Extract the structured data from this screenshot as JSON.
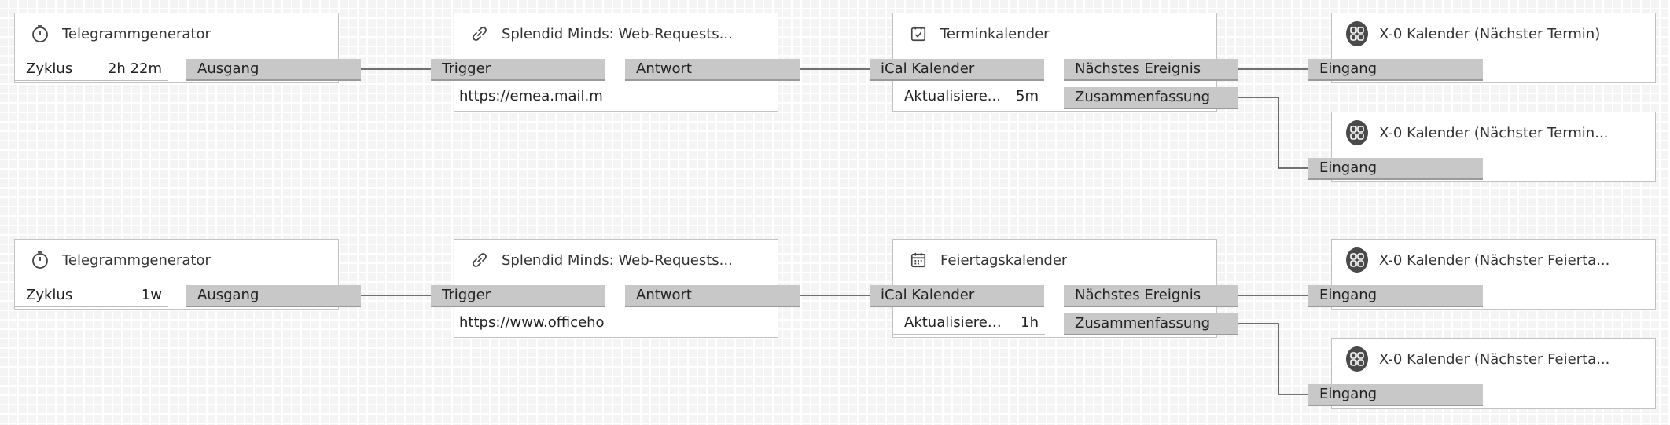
{
  "rows": [
    {
      "generator": {
        "title": "Telegrammgenerator",
        "param_label": "Zyklus",
        "param_value": "2h 22m",
        "output": "Ausgang",
        "icon": "timer-icon"
      },
      "request": {
        "title": "Splendid Minds: Web-Requests...",
        "input": "Trigger",
        "output": "Antwort",
        "url": "https://emea.mail.m",
        "icon": "link-icon"
      },
      "calendar": {
        "title": "Terminkalender",
        "input": "iCal Kalender",
        "param_label": "Aktualisiere...",
        "param_value": "5m",
        "output_next": "Nächstes Ereignis",
        "output_summary": "Zusammenfassung",
        "icon": "calendar-check-icon"
      },
      "targets": [
        {
          "title": "X-0 Kalender (Nächster Termin)",
          "input": "Eingang",
          "icon": "apps-grid-icon"
        },
        {
          "title": "X-0 Kalender (Nächster Termin...",
          "input": "Eingang",
          "icon": "apps-grid-icon"
        }
      ]
    },
    {
      "generator": {
        "title": "Telegrammgenerator",
        "param_label": "Zyklus",
        "param_value": "1w",
        "output": "Ausgang",
        "icon": "timer-icon"
      },
      "request": {
        "title": "Splendid Minds: Web-Requests...",
        "input": "Trigger",
        "output": "Antwort",
        "url": "https://www.officeho",
        "icon": "link-icon"
      },
      "calendar": {
        "title": "Feiertagskalender",
        "input": "iCal Kalender",
        "param_label": "Aktualisieren...",
        "param_value": "1h",
        "output_next": "Nächstes Ereignis",
        "output_summary": "Zusammenfassung",
        "icon": "calendar-grid-icon"
      },
      "targets": [
        {
          "title": "X-0 Kalender (Nächster Feierta...",
          "input": "Eingang",
          "icon": "apps-grid-icon"
        },
        {
          "title": "X-0 Kalender (Nächster Feierta...",
          "input": "Eingang",
          "icon": "apps-grid-icon"
        }
      ]
    }
  ],
  "colors": {
    "port": "#c8c8c8",
    "wire": "#444444",
    "badge": "#4a4a4a",
    "canvas": "#f4f4f4"
  }
}
